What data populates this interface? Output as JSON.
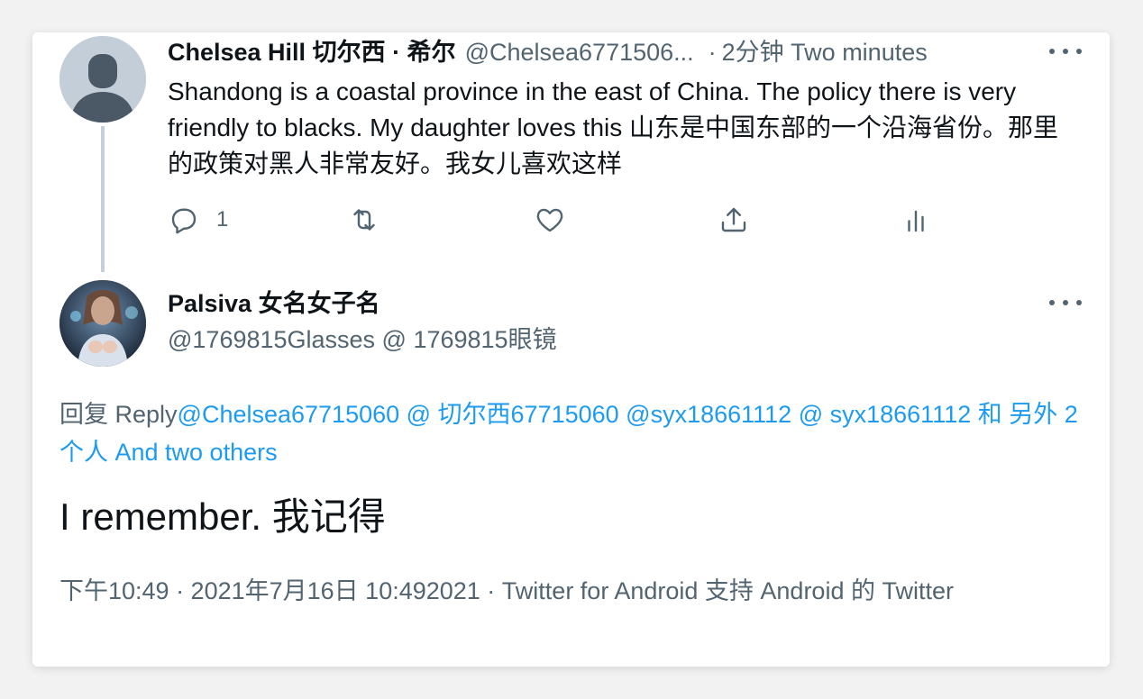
{
  "tweet1": {
    "display_name": "Chelsea Hill 切尔西 · 希尔",
    "handle": "@Chelsea6771506...",
    "separator": "·",
    "time": "2分钟 Two minutes",
    "text": "Shandong is a coastal province in the east of China. The policy there is very friendly to blacks. My daughter loves this 山东是中国东部的一个沿海省份。那里的政策对黑人非常友好。我女儿喜欢这样",
    "actions": {
      "reply_icon": "reply-icon",
      "reply_count": "1",
      "retweet_icon": "retweet-icon",
      "like_icon": "like-icon",
      "share_icon": "share-icon",
      "analytics_icon": "analytics-icon"
    }
  },
  "tweet2": {
    "display_name": "Palsiva 女名女子名",
    "handle": "@1769815Glasses @ 1769815眼镜",
    "reply_prefix": "回复  Reply",
    "reply_mentions": "@Chelsea67715060 @ 切尔西67715060 @syx18661112 @ syx18661112 和 另外 2 个人 And two others",
    "text": "I remember. 我记得",
    "meta": "下午10:49 · 2021年7月16日 10:492021 · Twitter for Android 支持 Android 的 Twitter"
  },
  "colors": {
    "text_primary": "#0f1419",
    "text_secondary": "#536471",
    "link": "#1d9bf0",
    "thread_line": "#c6cfd8"
  }
}
